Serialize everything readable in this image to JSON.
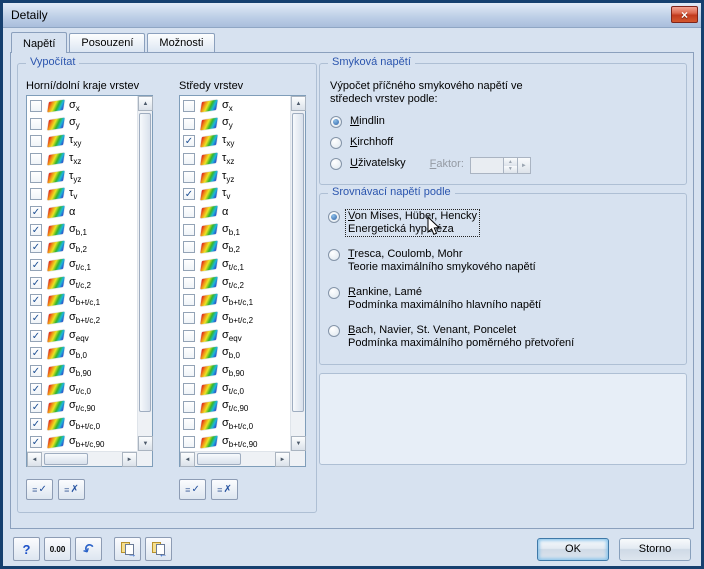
{
  "window": {
    "title": "Detaily",
    "close_glyph": "×"
  },
  "tabs": [
    {
      "id": "napeti",
      "label": "Napětí",
      "active": true
    },
    {
      "id": "posouzeni",
      "label": "Posouzení",
      "active": false
    },
    {
      "id": "moznosti",
      "label": "Možnosti",
      "active": false
    }
  ],
  "calculate_group": {
    "title": "Vypočítat",
    "columns": [
      {
        "id": "top-bottom-layers",
        "header": "Horní/dolní kraje vrstev",
        "items": [
          {
            "sym": "σ",
            "sub": "x",
            "checked": false
          },
          {
            "sym": "σ",
            "sub": "y",
            "checked": false
          },
          {
            "sym": "τ",
            "sub": "xy",
            "checked": false
          },
          {
            "sym": "τ",
            "sub": "xz",
            "checked": false
          },
          {
            "sym": "τ",
            "sub": "yz",
            "checked": false
          },
          {
            "sym": "τ",
            "sub": "v",
            "checked": false
          },
          {
            "sym": "α",
            "sub": "",
            "checked": true
          },
          {
            "sym": "σ",
            "sub": "b,1",
            "checked": true
          },
          {
            "sym": "σ",
            "sub": "b,2",
            "checked": true
          },
          {
            "sym": "σ",
            "sub": "t/c,1",
            "checked": true
          },
          {
            "sym": "σ",
            "sub": "t/c,2",
            "checked": true
          },
          {
            "sym": "σ",
            "sub": "b+t/c,1",
            "checked": true
          },
          {
            "sym": "σ",
            "sub": "b+t/c,2",
            "checked": true
          },
          {
            "sym": "σ",
            "sub": "eqv",
            "checked": true
          },
          {
            "sym": "σ",
            "sub": "b,0",
            "checked": true
          },
          {
            "sym": "σ",
            "sub": "b,90",
            "checked": true
          },
          {
            "sym": "σ",
            "sub": "t/c,0",
            "checked": true
          },
          {
            "sym": "σ",
            "sub": "t/c,90",
            "checked": true
          },
          {
            "sym": "σ",
            "sub": "b+t/c,0",
            "checked": true
          },
          {
            "sym": "σ",
            "sub": "b+t/c,90",
            "checked": true
          }
        ]
      },
      {
        "id": "layer-centers",
        "header": "Středy vrstev",
        "items": [
          {
            "sym": "σ",
            "sub": "x",
            "checked": false
          },
          {
            "sym": "σ",
            "sub": "y",
            "checked": false
          },
          {
            "sym": "τ",
            "sub": "xy",
            "checked": true
          },
          {
            "sym": "τ",
            "sub": "xz",
            "checked": false
          },
          {
            "sym": "τ",
            "sub": "yz",
            "checked": false
          },
          {
            "sym": "τ",
            "sub": "v",
            "checked": true
          },
          {
            "sym": "α",
            "sub": "",
            "checked": false
          },
          {
            "sym": "σ",
            "sub": "b,1",
            "checked": false
          },
          {
            "sym": "σ",
            "sub": "b,2",
            "checked": false
          },
          {
            "sym": "σ",
            "sub": "t/c,1",
            "checked": false
          },
          {
            "sym": "σ",
            "sub": "t/c,2",
            "checked": false
          },
          {
            "sym": "σ",
            "sub": "b+t/c,1",
            "checked": false
          },
          {
            "sym": "σ",
            "sub": "b+t/c,2",
            "checked": false
          },
          {
            "sym": "σ",
            "sub": "eqv",
            "checked": false
          },
          {
            "sym": "σ",
            "sub": "b,0",
            "checked": false
          },
          {
            "sym": "σ",
            "sub": "b,90",
            "checked": false
          },
          {
            "sym": "σ",
            "sub": "t/c,0",
            "checked": false
          },
          {
            "sym": "σ",
            "sub": "t/c,90",
            "checked": false
          },
          {
            "sym": "σ",
            "sub": "b+t/c,0",
            "checked": false
          },
          {
            "sym": "σ",
            "sub": "b+t/c,90",
            "checked": false
          }
        ]
      }
    ],
    "list_buttons": [
      {
        "id": "select-all",
        "lines_glyph": "≡",
        "mark_glyph": "✓"
      },
      {
        "id": "deselect-all",
        "lines_glyph": "≡",
        "mark_glyph": "✗"
      }
    ]
  },
  "shear_group": {
    "title": "Smyková napětí",
    "description": "Výpočet příčného smykového napětí ve středech vrstev podle:",
    "options": [
      {
        "id": "mindlin",
        "label": "Mindlin",
        "selected": true,
        "underline": true
      },
      {
        "id": "kirchhoff",
        "label": "Kirchhoff",
        "selected": false,
        "underline": true
      },
      {
        "id": "uzivatelsky",
        "label": "Uživatelsky",
        "selected": false,
        "underline": true,
        "factor": {
          "label": "Faktor:",
          "value": "",
          "disabled": true
        }
      }
    ]
  },
  "equivalent_group": {
    "title": "Srovnávací napětí podle",
    "options": [
      {
        "id": "von-mises",
        "label": "Von Mises, Hüber, Hencky",
        "sublabel": "Energetická hypotéza",
        "selected": true,
        "underline": true,
        "focused": true
      },
      {
        "id": "tresca",
        "label": "Tresca, Coulomb, Mohr",
        "sublabel": "Teorie maximálního smykového napětí",
        "selected": false,
        "underline": true
      },
      {
        "id": "rankine",
        "label": "Rankine, Lamé",
        "sublabel": "Podmínka maximálního hlavního napětí",
        "selected": false,
        "underline": true
      },
      {
        "id": "bach",
        "label": "Bach, Navier, St. Venant, Poncelet",
        "sublabel": "Podmínka maximálního poměrného přetvoření",
        "selected": false,
        "underline": true
      }
    ]
  },
  "footer": {
    "tool_buttons": [
      {
        "id": "help",
        "icon": "help-icon",
        "glyph": "?"
      },
      {
        "id": "units",
        "icon": "units-icon",
        "glyph": "0.00"
      },
      {
        "id": "reset-defaults",
        "icon": "reset-arrow-icon",
        "glyph": "↶"
      },
      {
        "id": "save-default",
        "icon": "doc-export-icon",
        "glyph": "→",
        "gap": true
      },
      {
        "id": "load-default",
        "icon": "doc-import-icon",
        "glyph": "←"
      }
    ],
    "ok_label": "OK",
    "cancel_label": "Storno"
  }
}
